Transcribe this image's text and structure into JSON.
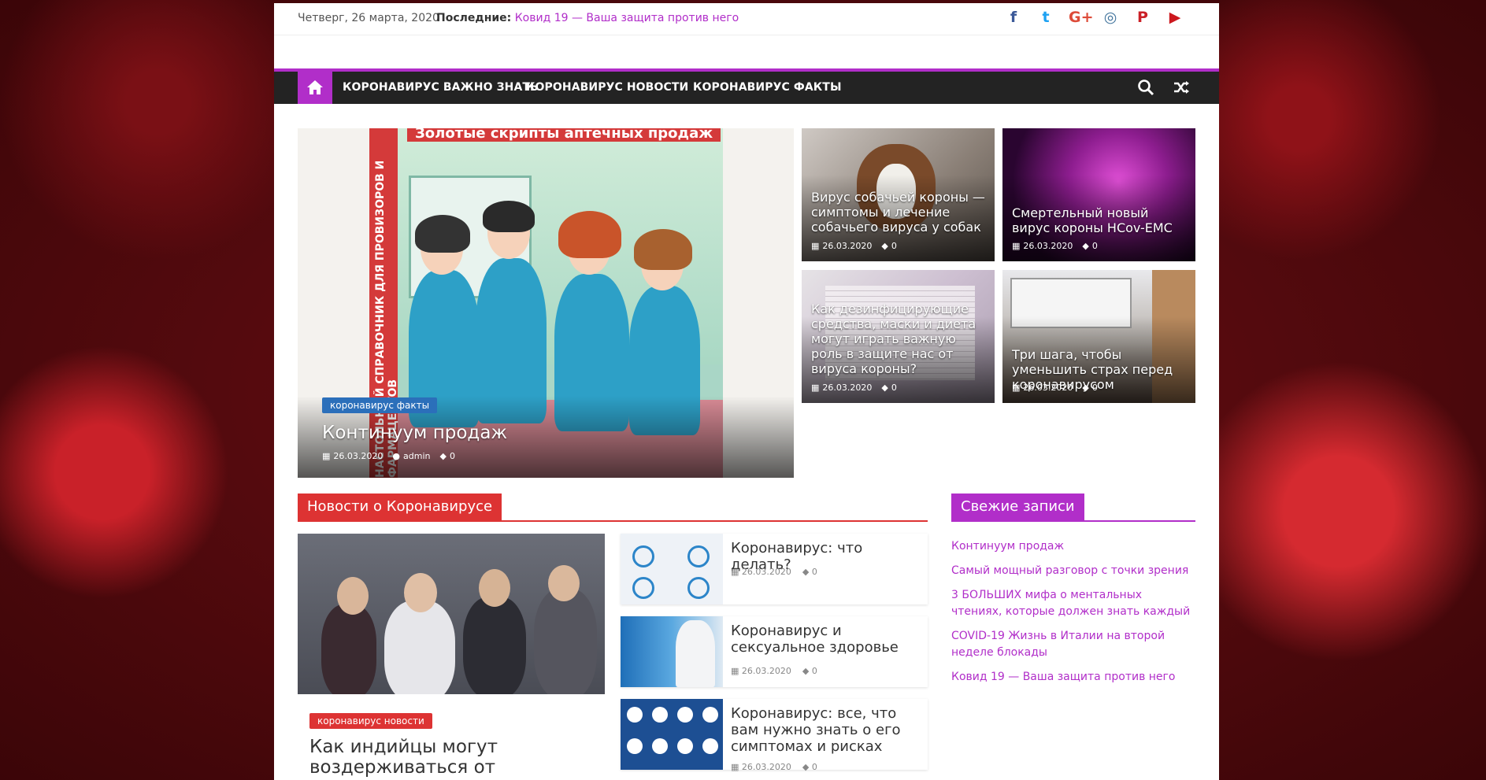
{
  "topbar": {
    "date": "Четверг, 26 марта, 2020",
    "latest_label": "Последние:",
    "latest_link": "Ковид 19 — Ваша защита против него",
    "social": [
      {
        "name": "facebook-icon",
        "glyph": "f",
        "color": "#3b5998"
      },
      {
        "name": "twitter-icon",
        "glyph": "t",
        "color": "#1da1f2"
      },
      {
        "name": "google-plus-icon",
        "glyph": "G+",
        "color": "#dd4b39"
      },
      {
        "name": "instagram-icon",
        "glyph": "◎",
        "color": "#3f729b"
      },
      {
        "name": "pinterest-icon",
        "glyph": "P",
        "color": "#cb2027"
      },
      {
        "name": "youtube-icon",
        "glyph": "▶",
        "color": "#cc181e"
      }
    ]
  },
  "nav": {
    "items": [
      "КОРОНАВИРУС ВАЖНО ЗНАТЬ",
      "КОРОНАВИРУС НОВОСТИ",
      "КОРОНАВИРУС ФАКТЫ"
    ]
  },
  "slider": {
    "category": "коронавирус факты",
    "category_color": "#2b6fba",
    "title": "Континуум продаж",
    "date": "26.03.2020",
    "author": "admin",
    "comments": "0",
    "poster_header": "Золотые скрипты аптечных продаж",
    "poster_band": "НАСТОЛЬНЫЙ СПРАВОЧНИК ДЛЯ ПРОВИЗОРОВ И ФАРМАЦЕВТОВ"
  },
  "grid": [
    {
      "title": "Вирус собачьей короны — симптомы и лечение собачьего вируса у собак",
      "date": "26.03.2020",
      "comments": "0"
    },
    {
      "title": "Смертельный новый вирус короны HCov-EMC",
      "date": "26.03.2020",
      "comments": "0"
    },
    {
      "title": "Как дезинфицирующие средства, маски и диета могут играть важную роль в защите нас от вируса короны?",
      "date": "26.03.2020",
      "comments": "0"
    },
    {
      "title": "Три шага, чтобы уменьшить страх перед коронавирусом",
      "date": "26.03.2020",
      "comments": "0"
    }
  ],
  "news_section": {
    "heading": "Новости о Коронавирусе",
    "color": "#dd3333",
    "feature": {
      "category": "коронавирус новости",
      "category_color": "#dd3333",
      "title": "Как индийцы могут воздерживаться от"
    },
    "items": [
      {
        "title": "Коронавирус: что делать?",
        "date": "26.03.2020",
        "comments": "0"
      },
      {
        "title": "Коронавирус и сексуальное здоровье",
        "date": "26.03.2020",
        "comments": "0"
      },
      {
        "title": "Коронавирус: все, что вам нужно знать о его симптомах и рисках",
        "date": "26.03.2020",
        "comments": "0"
      }
    ]
  },
  "sidebar": {
    "heading": "Свежие записи",
    "color": "#b12ec9",
    "links": [
      "Континуум продаж",
      "Самый мощный разговор с точки зрения",
      "3 БОЛЬШИХ мифа о ментальных чтениях, которые должен знать каждый",
      "COVID-19 Жизнь в Италии на второй неделе блокады",
      "Ковид 19 — Ваша защита против него"
    ]
  },
  "colors": {
    "accent": "#b12ec9",
    "nav_bg": "#232323"
  }
}
